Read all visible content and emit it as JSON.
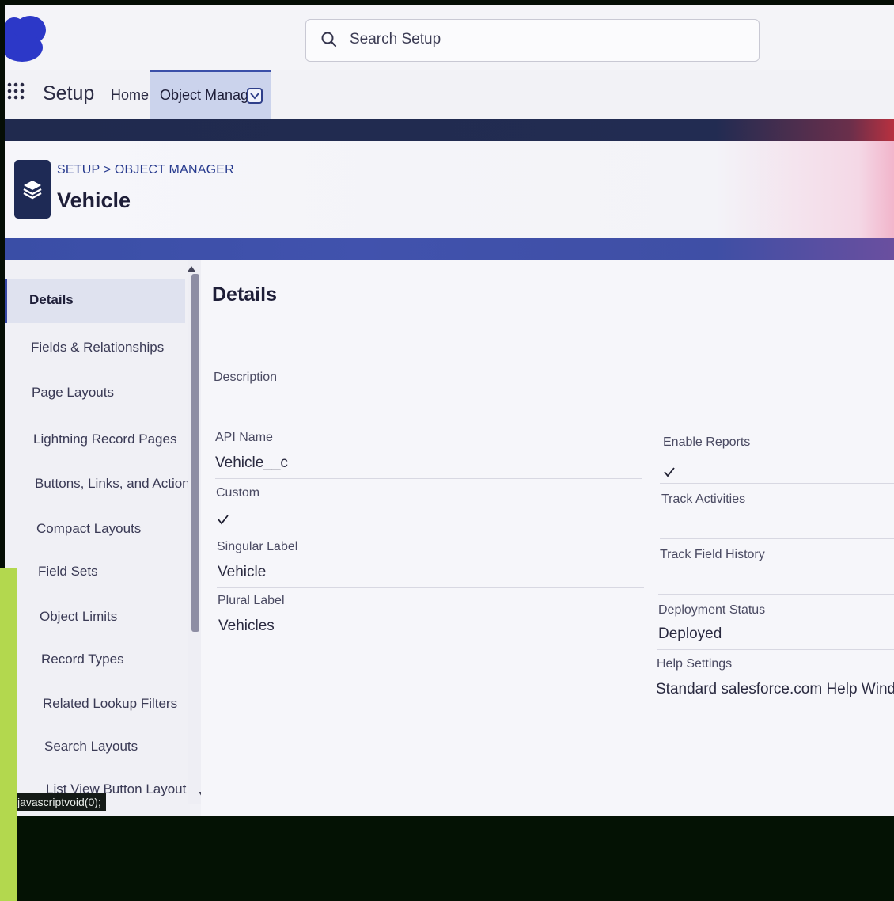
{
  "header": {
    "search_placeholder": "Search Setup",
    "search_icon": "search-icon",
    "logo_icon": "cloud-logo"
  },
  "nav": {
    "app_name": "Setup",
    "home_label": "Home",
    "object_manager_label": "Object Manager"
  },
  "page_header": {
    "breadcrumb": "SETUP > OBJECT MANAGER",
    "title": "Vehicle",
    "icon": "layers-icon"
  },
  "sidebar": {
    "items": [
      {
        "label": "Details",
        "active": true
      },
      {
        "label": "Fields & Relationships"
      },
      {
        "label": "Page Layouts"
      },
      {
        "label": "Lightning Record Pages"
      },
      {
        "label": "Buttons, Links, and Actions"
      },
      {
        "label": "Compact Layouts"
      },
      {
        "label": "Field Sets"
      },
      {
        "label": "Object Limits"
      },
      {
        "label": "Record Types"
      },
      {
        "label": "Related Lookup Filters"
      },
      {
        "label": "Search Layouts"
      },
      {
        "label": "List View Button Layout"
      }
    ]
  },
  "details": {
    "title": "Details",
    "description_label": "Description",
    "left": {
      "api_name_label": "API Name",
      "api_name_value": "Vehicle__c",
      "custom_label": "Custom",
      "custom_checked": true,
      "singular_label_label": "Singular Label",
      "singular_label_value": "Vehicle",
      "plural_label_label": "Plural Label",
      "plural_label_value": "Vehicles"
    },
    "right": {
      "enable_reports_label": "Enable Reports",
      "enable_reports_checked": true,
      "track_activities_label": "Track Activities",
      "track_field_history_label": "Track Field History",
      "deployment_status_label": "Deployment Status",
      "deployment_status_value": "Deployed",
      "help_settings_label": "Help Settings",
      "help_settings_value": "Standard salesforce.com Help Window"
    }
  },
  "status_bar": {
    "text": "javascriptvoid(0);"
  },
  "colors": {
    "brand_blue": "#3a4fa8",
    "navy": "#202a4e",
    "active_tab": "#cbd3ec"
  }
}
